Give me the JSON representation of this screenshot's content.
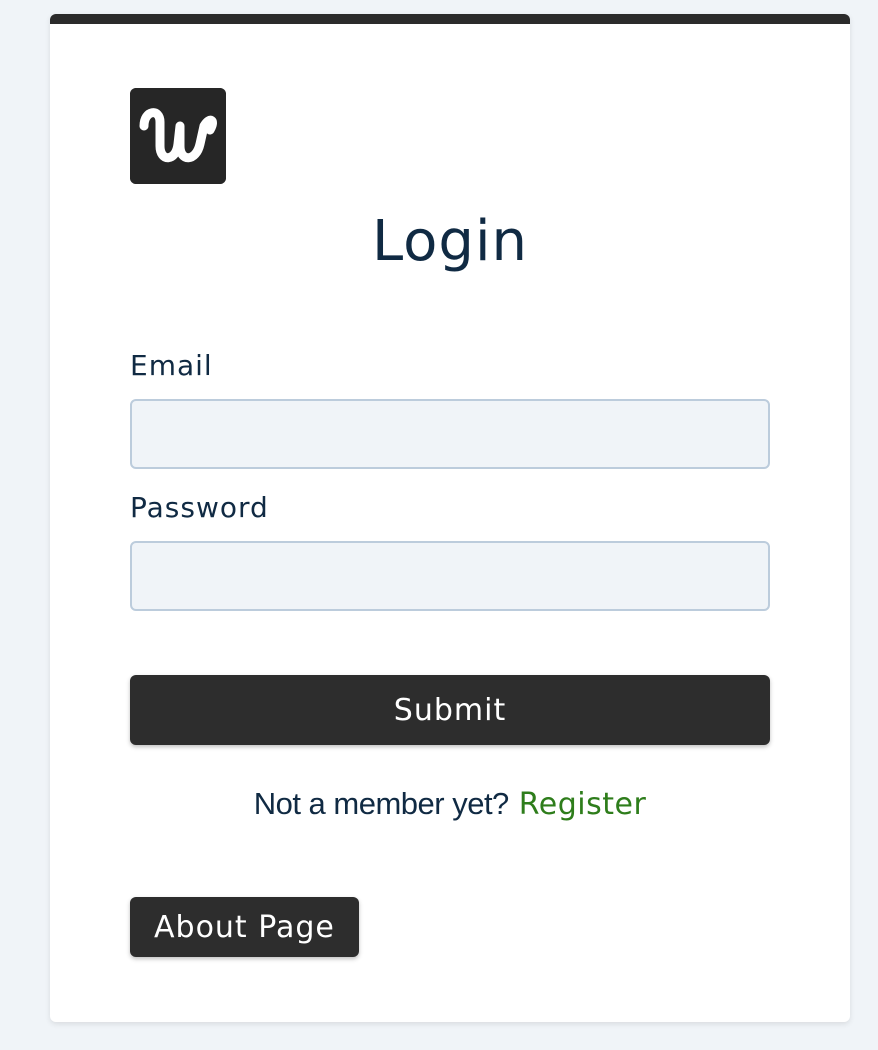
{
  "logo": {
    "icon": "w-logo-icon",
    "letter": "w",
    "background": "#262626",
    "foreground": "#ffffff"
  },
  "title": "Login",
  "form": {
    "email_label": "Email",
    "email_value": "",
    "password_label": "Password",
    "password_value": "",
    "submit_label": "Submit"
  },
  "member": {
    "question": "Not a member yet?",
    "register_label": "Register",
    "register_color": "#2e7d1b"
  },
  "about_label": "About Page",
  "colors": {
    "page_background": "#f0f4f8",
    "card_top_border": "#2b2b2b",
    "button_background": "#2d2d2d",
    "text": "#102a43",
    "input_background": "#f0f4f8",
    "input_border": "#bcccdc"
  }
}
